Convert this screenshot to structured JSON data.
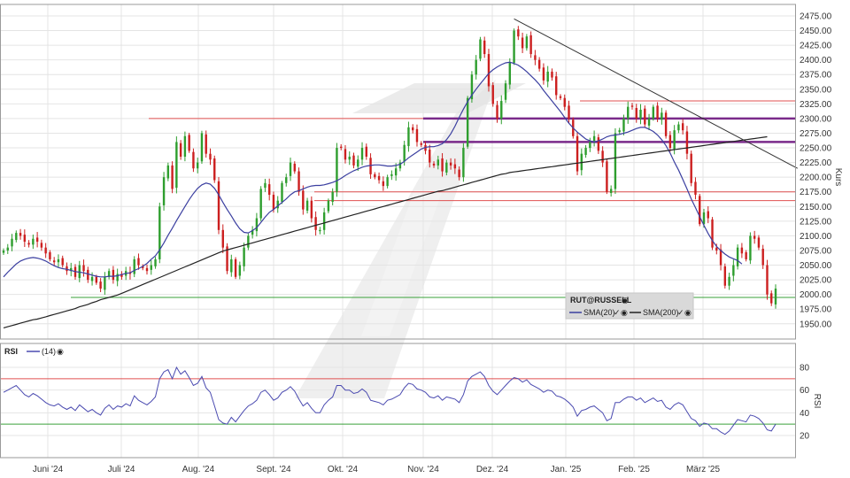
{
  "colors": {
    "up": "#2e9e2e",
    "down": "#cc1f1f",
    "sma20": "#3b3fa0",
    "sma200": "#222222",
    "resistance_red": "#e05050",
    "support_purple": "#7a2a8a",
    "support_green": "#3aa03a",
    "rsi_line": "#4a4ab0",
    "grid": "#e4e4e4",
    "watermark": "#e2e2e2"
  },
  "legend": {
    "symbol": "RUT@RUSSELL",
    "sma20_label": "SMA(20)",
    "sma200_label": "SMA(200)",
    "check_mark": "✓",
    "icon_glyph": "◉"
  },
  "rsi_panel": {
    "name": "RSI",
    "period_label": "(14)",
    "axis_title": "RSI",
    "ticks": [
      "80",
      "60",
      "40",
      "20"
    ],
    "overbought": 70,
    "oversold": 30
  },
  "chart_data": {
    "type": "candlestick",
    "ylabel": "Kurs",
    "ylim": [
      1925,
      2490
    ],
    "yticks": [
      1950,
      1975,
      2000,
      2025,
      2050,
      2075,
      2100,
      2125,
      2150,
      2175,
      2200,
      2225,
      2250,
      2275,
      2300,
      2325,
      2350,
      2375,
      2400,
      2425,
      2450,
      2475
    ],
    "ytick_labels": [
      "1950.00",
      "1975.00",
      "2000.00",
      "2025.00",
      "2050.00",
      "2075.00",
      "2100.00",
      "2125.00",
      "2150.00",
      "2175.00",
      "2200.00",
      "2225.00",
      "2250.00",
      "2275.00",
      "2300.00",
      "2325.00",
      "2350.00",
      "2375.00",
      "2400.00",
      "2425.00",
      "2450.00",
      "2475.00"
    ],
    "x_labels": [
      "Juni '24",
      "Juli '24",
      "Aug. '24",
      "Sept. '24",
      "Okt. '24",
      "Nov. '24",
      "Dez. '24",
      "Jan. '25",
      "Feb. '25",
      "März '25"
    ],
    "close": [
      2075,
      2080,
      2095,
      2105,
      2100,
      2090,
      2085,
      2095,
      2090,
      2080,
      2070,
      2060,
      2055,
      2060,
      2050,
      2040,
      2045,
      2030,
      2050,
      2040,
      2025,
      2030,
      2020,
      2010,
      2030,
      2040,
      2025,
      2035,
      2030,
      2040,
      2035,
      2060,
      2050,
      2045,
      2040,
      2050,
      2060,
      2150,
      2200,
      2220,
      2180,
      2260,
      2235,
      2270,
      2245,
      2215,
      2225,
      2275,
      2240,
      2230,
      2195,
      2110,
      2080,
      2040,
      2060,
      2030,
      2050,
      2080,
      2100,
      2110,
      2130,
      2180,
      2190,
      2170,
      2145,
      2160,
      2190,
      2200,
      2225,
      2210,
      2175,
      2145,
      2160,
      2130,
      2110,
      2110,
      2140,
      2160,
      2175,
      2250,
      2250,
      2230,
      2235,
      2220,
      2230,
      2250,
      2235,
      2205,
      2200,
      2195,
      2185,
      2200,
      2205,
      2215,
      2225,
      2255,
      2285,
      2280,
      2260,
      2255,
      2245,
      2225,
      2220,
      2230,
      2210,
      2225,
      2220,
      2215,
      2200,
      2250,
      2335,
      2375,
      2400,
      2435,
      2410,
      2355,
      2325,
      2300,
      2330,
      2360,
      2395,
      2450,
      2440,
      2420,
      2440,
      2410,
      2400,
      2385,
      2365,
      2380,
      2370,
      2340,
      2335,
      2320,
      2300,
      2270,
      2210,
      2240,
      2250,
      2260,
      2270,
      2245,
      2225,
      2175,
      2180,
      2275,
      2280,
      2300,
      2320,
      2320,
      2300,
      2315,
      2290,
      2300,
      2320,
      2300,
      2310,
      2270,
      2250,
      2280,
      2290,
      2280,
      2240,
      2190,
      2170,
      2120,
      2140,
      2130,
      2080,
      2075,
      2050,
      2015,
      2030,
      2050,
      2080,
      2070,
      2060,
      2100,
      2095,
      2080,
      2050,
      2000,
      1985,
      2010
    ],
    "series": [
      {
        "name": "SMA(20)",
        "values": [
          2030,
          2038,
          2045,
          2052,
          2057,
          2060,
          2062,
          2063,
          2062,
          2060,
          2057,
          2053,
          2049,
          2046,
          2044,
          2043,
          2041,
          2039,
          2038,
          2037,
          2035,
          2033,
          2031,
          2030,
          2030,
          2031,
          2031,
          2032,
          2034,
          2036,
          2037,
          2041,
          2044,
          2048,
          2053,
          2060,
          2066,
          2076,
          2088,
          2101,
          2113,
          2126,
          2138,
          2150,
          2162,
          2172,
          2181,
          2187,
          2190,
          2188,
          2181,
          2170,
          2157,
          2145,
          2134,
          2122,
          2112,
          2106,
          2105,
          2109,
          2114,
          2123,
          2132,
          2140,
          2145,
          2151,
          2157,
          2163,
          2170,
          2175,
          2177,
          2180,
          2183,
          2185,
          2186,
          2186,
          2187,
          2189,
          2191,
          2194,
          2198,
          2203,
          2207,
          2211,
          2214,
          2217,
          2219,
          2220,
          2221,
          2221,
          2220,
          2219,
          2219,
          2220,
          2222,
          2227,
          2233,
          2238,
          2243,
          2248,
          2251,
          2252,
          2252,
          2254,
          2257,
          2264,
          2274,
          2287,
          2302,
          2316,
          2329,
          2340,
          2350,
          2359,
          2368,
          2377,
          2383,
          2388,
          2392,
          2395,
          2396,
          2394,
          2391,
          2386,
          2380,
          2373,
          2366,
          2358,
          2348,
          2339,
          2330,
          2321,
          2312,
          2302,
          2292,
          2284,
          2277,
          2271,
          2265,
          2262,
          2260,
          2262,
          2265,
          2269,
          2271,
          2272,
          2273,
          2275,
          2277,
          2280,
          2283,
          2285,
          2285,
          2282,
          2278,
          2272,
          2264,
          2254,
          2241,
          2226,
          2212,
          2196,
          2180,
          2163,
          2148,
          2133,
          2118,
          2104,
          2092,
          2082,
          2075,
          2069,
          2064,
          2061,
          2058,
          2052
        ]
      },
      {
        "name": "SMA(200)",
        "values": [
          1943,
          1945,
          1947,
          1949,
          1951,
          1953,
          1955,
          1957,
          1958,
          1960,
          1962,
          1964,
          1966,
          1968,
          1970,
          1972,
          1974,
          1976,
          1979,
          1981,
          1983,
          1986,
          1988,
          1991,
          1993,
          1995,
          1997,
          1999,
          2002,
          2005,
          2008,
          2011,
          2014,
          2017,
          2020,
          2023,
          2026,
          2029,
          2032,
          2035,
          2038,
          2041,
          2044,
          2047,
          2050,
          2053,
          2056,
          2059,
          2062,
          2065,
          2068,
          2071,
          2074,
          2076,
          2078,
          2080,
          2082,
          2084,
          2086,
          2088,
          2090,
          2092,
          2094,
          2096,
          2098,
          2100,
          2102,
          2104,
          2106,
          2108,
          2110,
          2112,
          2114,
          2116,
          2118,
          2120,
          2122,
          2124,
          2126,
          2128,
          2130,
          2132,
          2134,
          2136,
          2138,
          2140,
          2142,
          2144,
          2146,
          2148,
          2150,
          2152,
          2154,
          2156,
          2158,
          2160,
          2162,
          2164,
          2166,
          2168,
          2170,
          2172,
          2174,
          2176,
          2177,
          2179,
          2181,
          2183,
          2185,
          2187,
          2189,
          2191,
          2193,
          2195,
          2197,
          2199,
          2201,
          2203,
          2205,
          2206,
          2208,
          2209,
          2210,
          2211,
          2212,
          2213,
          2214,
          2215,
          2216,
          2217,
          2218,
          2219,
          2220,
          2221,
          2222,
          2223,
          2224,
          2225,
          2226,
          2227,
          2228,
          2229,
          2230,
          2231,
          2232,
          2233,
          2234,
          2235,
          2236,
          2237,
          2238,
          2239,
          2240,
          2241,
          2242,
          2243,
          2244,
          2245,
          2246,
          2247,
          2248,
          2249,
          2250,
          2251,
          2252,
          2253,
          2254,
          2255,
          2256,
          2257,
          2258,
          2259,
          2260,
          2261,
          2262,
          2263,
          2264,
          2265,
          2266,
          2267,
          2268,
          2269
        ]
      },
      {
        "name": "RSI(14)",
        "values": [
          58,
          60,
          62,
          64,
          60,
          56,
          54,
          57,
          55,
          52,
          49,
          47,
          46,
          48,
          45,
          43,
          45,
          42,
          47,
          44,
          41,
          43,
          40,
          38,
          44,
          47,
          43,
          46,
          45,
          48,
          46,
          55,
          51,
          49,
          47,
          50,
          54,
          70,
          76,
          78,
          70,
          80,
          74,
          77,
          71,
          64,
          66,
          72,
          62,
          58,
          46,
          34,
          31,
          30,
          36,
          32,
          37,
          42,
          46,
          48,
          51,
          58,
          60,
          56,
          51,
          53,
          58,
          60,
          63,
          59,
          52,
          46,
          49,
          44,
          40,
          40,
          47,
          51,
          54,
          64,
          64,
          60,
          60,
          57,
          58,
          61,
          58,
          51,
          50,
          49,
          47,
          51,
          52,
          54,
          56,
          62,
          66,
          65,
          61,
          60,
          58,
          54,
          53,
          55,
          51,
          54,
          53,
          52,
          49,
          56,
          68,
          72,
          74,
          76,
          72,
          64,
          59,
          56,
          60,
          64,
          68,
          71,
          70,
          67,
          69,
          65,
          63,
          61,
          58,
          60,
          59,
          55,
          54,
          52,
          49,
          45,
          37,
          42,
          43,
          45,
          46,
          43,
          40,
          33,
          35,
          49,
          49,
          52,
          54,
          54,
          51,
          53,
          49,
          51,
          53,
          50,
          51,
          45,
          43,
          47,
          49,
          47,
          41,
          35,
          33,
          28,
          31,
          30,
          26,
          26,
          23,
          21,
          24,
          29,
          34,
          33,
          32,
          38,
          37,
          35,
          31,
          25,
          24,
          30
        ]
      }
    ],
    "trendlines": {
      "downtrend": {
        "from_index": 121,
        "from_value": 2470,
        "to_index": 184,
        "to_value": 2215
      },
      "horizontal_red": [
        2300,
        2330,
        2175,
        2160
      ],
      "horizontal_purple": [
        2300,
        2260
      ],
      "horizontal_green": [
        1995
      ]
    },
    "grid": true
  }
}
